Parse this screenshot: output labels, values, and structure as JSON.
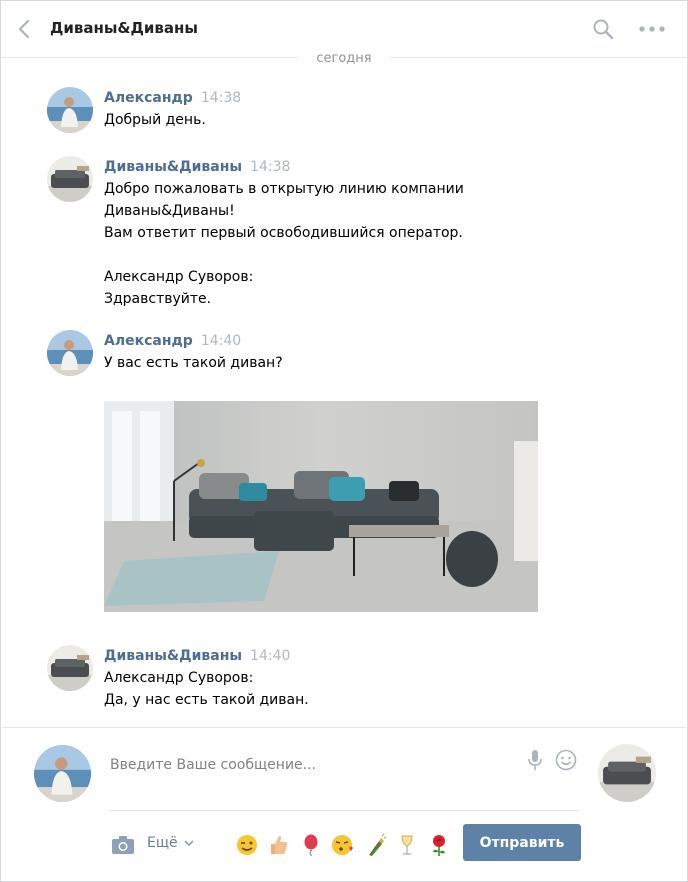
{
  "header": {
    "title": "Диваны&Диваны"
  },
  "date_separator": "сегодня",
  "messages": [
    {
      "author": "Александр",
      "time": "14:38",
      "lines": [
        "Добрый день."
      ]
    },
    {
      "author": "Диваны&Диваны",
      "time": "14:38",
      "lines": [
        "Добро пожаловать в открытую линию компании",
        "Диваны&Диваны!",
        "Вам ответит первый освободившийся оператор.",
        "",
        "Александр Суворов:",
        "Здравствуйте."
      ]
    },
    {
      "author": "Александр",
      "time": "14:40",
      "lines": [
        "У вас есть такой диван?"
      ]
    },
    {
      "author": "Диваны&Диваны",
      "time": "14:40",
      "lines": [
        "Александр Суворов:",
        "Да, у нас есть такой диван."
      ]
    }
  ],
  "composer": {
    "placeholder": "Введите Ваше сообщение...",
    "more_label": "Ещё",
    "send_label": "Отправить",
    "emojis": [
      "wink-emoji",
      "thumbs-up-emoji",
      "balloon-emoji",
      "kiss-emoji",
      "champagne-emoji",
      "cocktail-emoji",
      "rose-emoji"
    ]
  },
  "colors": {
    "accent": "#5e81a8",
    "author": "#4f6c92",
    "muted": "#939393"
  }
}
